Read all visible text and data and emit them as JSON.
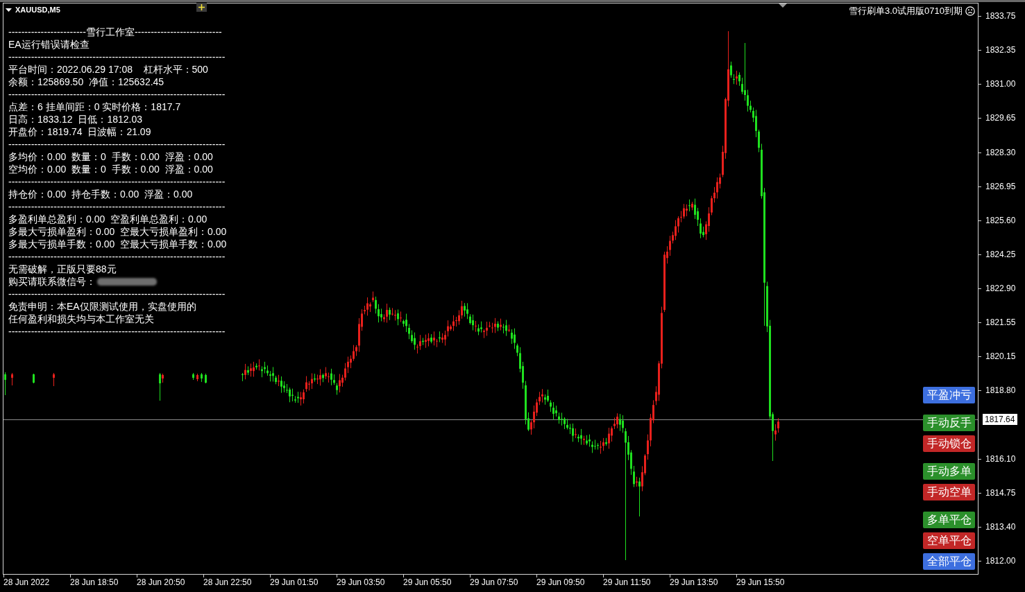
{
  "chart_header": {
    "symbol": "XAUUSD,M5"
  },
  "notice": {
    "text": "雪行刷单3.0试用版0710到期"
  },
  "info_panel": {
    "lines": [
      {
        "text": "------------------------雪行工作室---------------------------"
      },
      {
        "text": "EA运行错误请检查"
      },
      {
        "text": "-------------------------------------------------------------------"
      },
      {
        "text": "平台时间：2022.06.29 17:08    杠杆水平：500"
      },
      {
        "text": "余额：125869.50  净值：125632.45"
      },
      {
        "text": "-------------------------------------------------------------------"
      },
      {
        "text": "点差：6 挂单间距：0 实时价格：1817.7"
      },
      {
        "text": "日高：1833.12  日低：1812.03"
      },
      {
        "text": "开盘价：1819.74  日波幅：21.09"
      },
      {
        "text": "-------------------------------------------------------------------"
      },
      {
        "text": "多均价：0.00  数量：0  手数：0.00  浮盈：0.00"
      },
      {
        "text": "空均价：0.00  数量：0  手数：0.00  浮盈：0.00"
      },
      {
        "text": "-------------------------------------------------------------------"
      },
      {
        "text": "持仓价：0.00  持仓手数：0.00  浮盈：0.00"
      },
      {
        "text": "-------------------------------------------------------------------"
      },
      {
        "text": "多盈利单总盈利：0.00  空盈利单总盈利：0.00"
      },
      {
        "text": "多最大亏损单盈利：0.00  空最大亏损单盈利：0.00"
      },
      {
        "text": "多最大亏损单手数：0.00  空最大亏损单手数：0.00"
      },
      {
        "text": "-------------------------------------------------------------------"
      },
      {
        "text": "无需破解，正版只要88元"
      },
      {
        "text": "购买请联系微信号：",
        "redacted": true
      },
      {
        "text": "-------------------------------------------------------------------"
      },
      {
        "text": "免责申明：本EA仅限测试使用，实盘使用的"
      },
      {
        "text": "任何盈利和损失均与本工作室无关"
      },
      {
        "text": "-------------------------------------------------------------------"
      }
    ]
  },
  "action_buttons": [
    {
      "buttons": [
        {
          "label": "平盈冲亏",
          "color": "#3d6fdf"
        }
      ]
    },
    {
      "buttons": [
        {
          "label": "手动反手",
          "color": "#2b902b"
        },
        {
          "label": "手动锁仓",
          "color": "#c22727"
        }
      ]
    },
    {
      "buttons": [
        {
          "label": "手动多单",
          "color": "#2b902b"
        },
        {
          "label": "手动空单",
          "color": "#c22727"
        }
      ]
    },
    {
      "buttons": [
        {
          "label": "多单平仓",
          "color": "#2b902b"
        },
        {
          "label": "空单平仓",
          "color": "#c22727"
        },
        {
          "label": "全部平仓",
          "color": "#3d6fdf"
        }
      ]
    }
  ],
  "price_axis": {
    "labels_above": [
      "1833.75",
      "1832.35",
      "1831.00",
      "1829.65",
      "1828.30",
      "1826.95",
      "1825.60",
      "1824.25",
      "1822.90",
      "1821.55",
      "1820.15",
      "1818.80"
    ],
    "current_price": "1817.64",
    "labels_below": [
      "1816.10",
      "1814.75",
      "1813.40",
      "1812.00"
    ]
  },
  "time_axis": {
    "labels": [
      "28 Jun 2022",
      "28 Jun 18:50",
      "28 Jun 20:50",
      "28 Jun 22:50",
      "29 Jun 01:50",
      "29 Jun 03:50",
      "29 Jun 05:50",
      "29 Jun 07:50",
      "29 Jun 09:50",
      "29 Jun 11:50",
      "29 Jun 13:50",
      "29 Jun 15:50"
    ]
  }
}
